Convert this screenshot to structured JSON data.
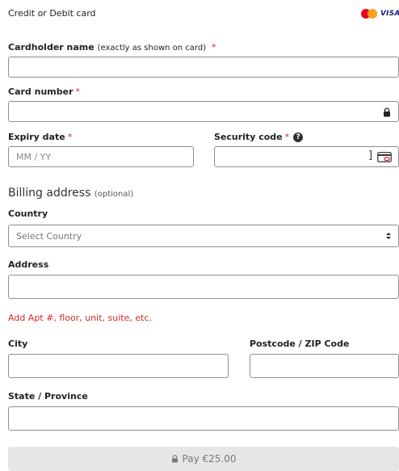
{
  "header": {
    "title": "Credit or Debit card",
    "brand_visa": "VISA"
  },
  "card": {
    "cardholder_label": "Cardholder name",
    "cardholder_hint": "(exactly as shown on card)",
    "required_mark": "*",
    "cardholder_value": "",
    "card_number_label": "Card number",
    "card_number_value": "",
    "expiry_label": "Expiry date",
    "expiry_placeholder": "MM / YY",
    "security_label": "Security code",
    "security_value": ""
  },
  "billing": {
    "title": "Billing address",
    "optional": "(optional)",
    "country_label": "Country",
    "country_selected": "Select Country",
    "address_label": "Address",
    "add_apt_link": "Add Apt #, floor, unit, suite, etc.",
    "city_label": "City",
    "postcode_label": "Postcode / ZIP Code",
    "state_label": "State / Province"
  },
  "pay_button": {
    "label": "Pay €25.00"
  },
  "colors": {
    "required": "#d22b2b",
    "border": "#8e8e8e",
    "button_bg": "#e6e6e6"
  }
}
